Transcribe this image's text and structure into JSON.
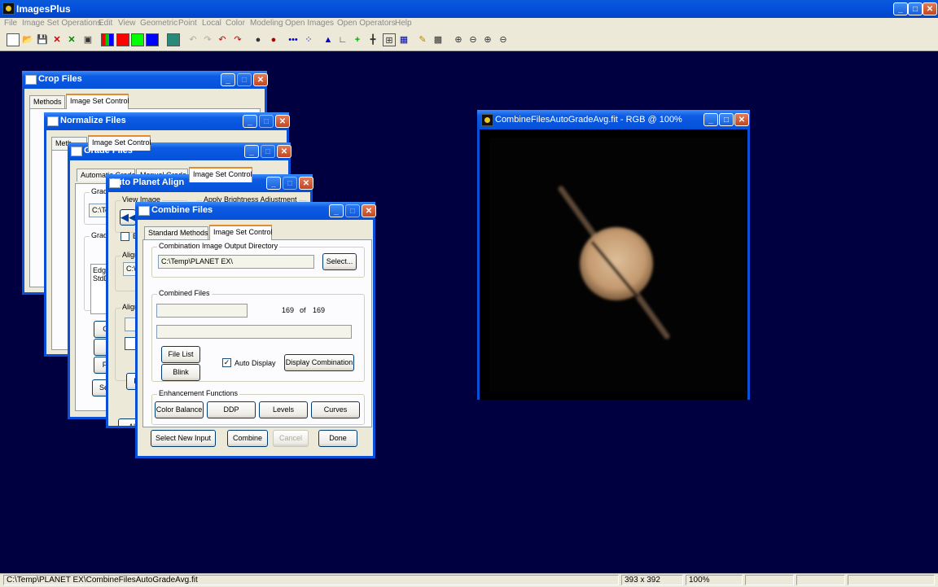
{
  "app": {
    "title": "ImagesPlus",
    "menu": [
      "File",
      "Image Set Operations",
      "Edit",
      "View",
      "Geometric",
      "Point",
      "Local",
      "Color",
      "Modeling",
      "Open Images",
      "Open Operators",
      "Help"
    ]
  },
  "toolbar": {
    "icons": [
      "new-file",
      "open-folder",
      "save",
      "close-x-red",
      "close-x-green",
      "print",
      "color-all",
      "color-red",
      "color-green",
      "color-blue",
      "channel-view",
      "undo",
      "redo",
      "undo-all",
      "redo-all",
      "mask-black",
      "mask-red",
      "line-dots",
      "scatter-dots",
      "triangle",
      "angle",
      "add-cross",
      "crosshair",
      "grid-select",
      "image-adjust",
      "pencil",
      "grid",
      "zoom-in",
      "zoom-out",
      "zoom-fit",
      "zoom-reset"
    ],
    "colors": {
      "red": "#ff0000",
      "green": "#00ff00",
      "blue": "#0000ff"
    }
  },
  "crop_window": {
    "title": "Crop Files",
    "tabs": [
      "Methods",
      "Image Set Control"
    ]
  },
  "normalize_window": {
    "title": "Normalize Files",
    "tabs": [
      "Meth...",
      "Image Set Control"
    ]
  },
  "grade_window": {
    "title": "Grade Files",
    "tabs": [
      "Automatic Grade",
      "Manual Grade",
      "Image Set Control"
    ],
    "frags": [
      "Grade",
      "C:\\Te",
      "Grade",
      "Edge",
      "StdD",
      "Cal",
      "C",
      "File",
      "Sele"
    ]
  },
  "align_window": {
    "title": "Auto Planet Align",
    "frags": [
      "View Image",
      "Apply Brightness Adjustment",
      "E",
      "Align",
      "C:\\",
      "Align",
      "F",
      "Al"
    ]
  },
  "combine_window": {
    "title": "Combine Files",
    "tabs": [
      "Standard Methods",
      "Image Set Control"
    ],
    "output_dir_label": "Combination Image Output Directory",
    "output_dir_value": "C:\\Temp\\PLANET EX\\",
    "select_label": "Select...",
    "combined_label": "Combined Files",
    "count_current": "169",
    "count_of": "of",
    "count_total": "169",
    "file_list_label": "File List",
    "blink_label": "Blink",
    "auto_display_label": "Auto Display",
    "auto_display_checked": true,
    "display_combination_label": "Display Combination",
    "enhancement_label": "Enhancement Functions",
    "color_balance_label": "Color Balance",
    "ddp_label": "DDP",
    "levels_label": "Levels",
    "curves_label": "Curves",
    "select_new_input_label": "Select New Input",
    "combine_label": "Combine",
    "cancel_label": "Cancel",
    "done_label": "Done"
  },
  "image_window": {
    "title": "CombineFilesAutoGradeAvg.fit - RGB @ 100%",
    "planet_color": "#d8b890"
  },
  "status": {
    "path": "C:\\Temp\\PLANET EX\\CombineFilesAutoGradeAvg.fit",
    "dimensions": "393 x 392",
    "zoom": "100%"
  }
}
